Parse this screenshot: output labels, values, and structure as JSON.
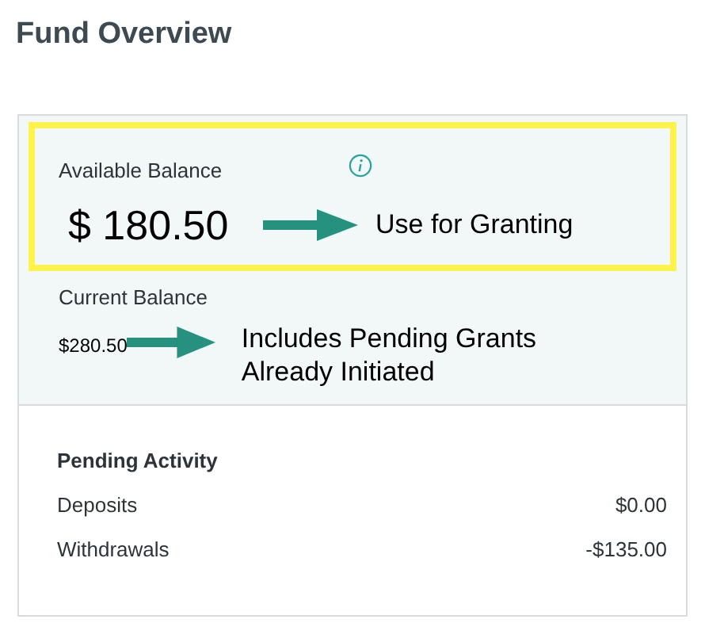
{
  "title": "Fund Overview",
  "available_balance": {
    "label": "Available Balance",
    "amount": "$ 180.50",
    "note": "Use for Granting",
    "highlighted": true
  },
  "current_balance": {
    "label": "Current Balance",
    "amount": "$280.50",
    "note": "Includes Pending Grants Already Initiated"
  },
  "pending_activity": {
    "title": "Pending Activity",
    "rows": [
      {
        "label": "Deposits",
        "value": "$0.00"
      },
      {
        "label": "Withdrawals",
        "value": "-$135.00"
      }
    ]
  }
}
